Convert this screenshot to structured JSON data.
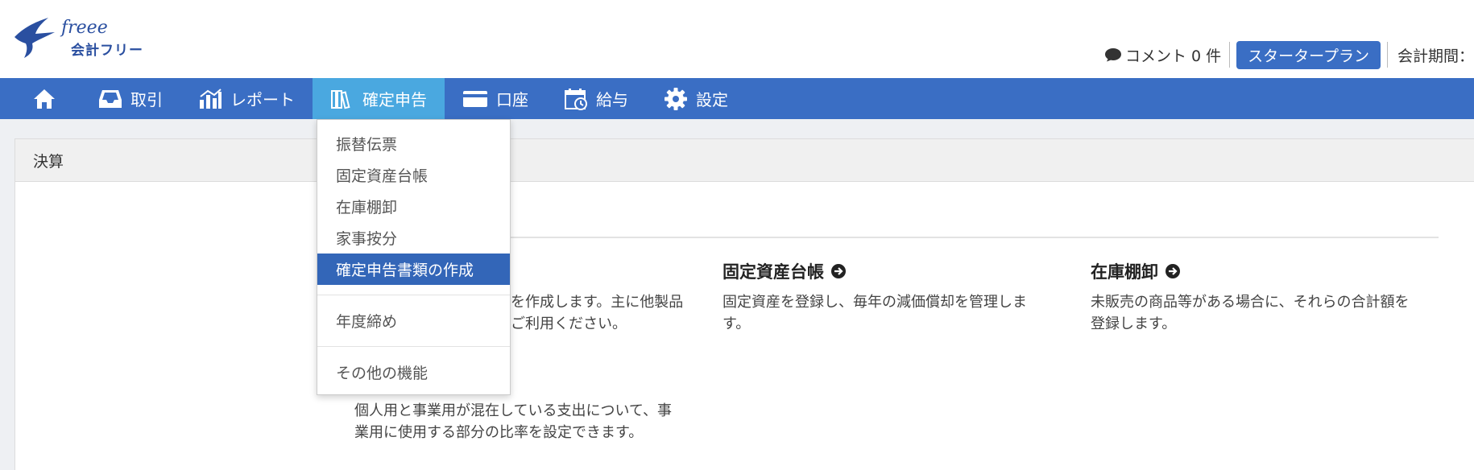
{
  "brand": {
    "script": "freee",
    "name": "会計フリー"
  },
  "header": {
    "comment_label": "コメント 0 件",
    "plan_button": "スタータープラン",
    "period_label": "会計期間："
  },
  "nav": {
    "torihiki": "取引",
    "report": "レポート",
    "kakutei": "確定申告",
    "koza": "口座",
    "kyuyo": "給与",
    "settei": "設定"
  },
  "dropdown": {
    "items": [
      "振替伝票",
      "固定資産台帳",
      "在庫棚卸",
      "家事按分",
      "確定申告書類の作成"
    ],
    "nendo": "年度締め",
    "other": "その他の機能"
  },
  "panel": {
    "title": "決算"
  },
  "cards": {
    "first_desc": [
      "を作成します。主に他製品",
      "ご利用ください。"
    ],
    "fixed": {
      "title": "固定資産台帳",
      "desc": [
        "固定資産を登録し、毎年の減価償却を管理しま",
        "す。"
      ]
    },
    "stock": {
      "title": "在庫棚卸",
      "desc": [
        "未販売の商品等がある場合に、それらの合計額を",
        "登録します。"
      ]
    },
    "kaji": {
      "desc": [
        "個人用と事業用が混在している支出について、事",
        "業用に使用する部分の比率を設定できます。"
      ]
    }
  },
  "colors": {
    "nav": "#3a6ec4",
    "nav_active": "#4aa8e0",
    "selected": "#3366b8"
  }
}
